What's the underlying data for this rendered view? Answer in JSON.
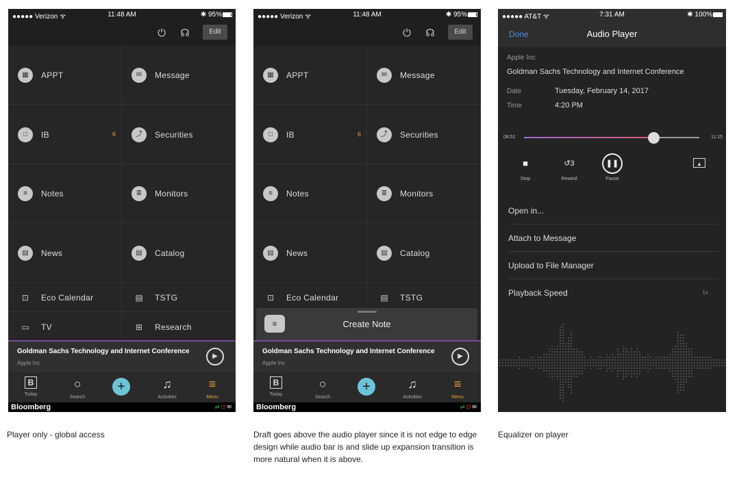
{
  "screens": [
    {
      "status": {
        "carrier": "●●●●● Verizon ᯤ",
        "time": "11:48 AM",
        "battery": "✱ 95%",
        "battery_level": 0.95
      },
      "edit_label": "Edit"
    },
    {
      "status": {
        "carrier": "●●●●● Verizon ᯤ",
        "time": "11:48 AM",
        "battery": "✱ 95%",
        "battery_level": 0.95
      },
      "edit_label": "Edit"
    }
  ],
  "tiles": [
    {
      "label": "APPT",
      "icon": "calendar-icon",
      "glyph": "▦"
    },
    {
      "label": "Message",
      "icon": "envelope-icon",
      "glyph": "✉"
    },
    {
      "label": "IB",
      "icon": "chat-icon",
      "glyph": "□",
      "badge": "6"
    },
    {
      "label": "Securities",
      "icon": "chart-icon",
      "glyph": "⤴"
    },
    {
      "label": "Notes",
      "icon": "notes-icon",
      "glyph": "≡"
    },
    {
      "label": "Monitors",
      "icon": "monitor-list-icon",
      "glyph": "≣"
    },
    {
      "label": "News",
      "icon": "news-icon",
      "glyph": "▤"
    },
    {
      "label": "Catalog",
      "icon": "catalog-icon",
      "glyph": "▤"
    },
    {
      "label": "Eco Calendar",
      "icon": "calendar-icon",
      "glyph": "⊡"
    },
    {
      "label": "TSTG",
      "icon": "news-icon",
      "glyph": "▤"
    },
    {
      "label": "TV",
      "icon": "tv-icon",
      "glyph": "▭"
    },
    {
      "label": "Research",
      "icon": "research-icon",
      "glyph": "⊞"
    }
  ],
  "player": {
    "title": "Goldman Sachs Technology and Internet Conference",
    "subtitle": "Apple Inc",
    "play_icon": "▶"
  },
  "tabs": [
    {
      "label": "Today",
      "glyph": "B",
      "icon": "bloomberg-b-icon"
    },
    {
      "label": "Search",
      "glyph": "○",
      "icon": "search-icon"
    },
    {
      "label": "Activities",
      "glyph": "♫",
      "icon": "bell-icon"
    },
    {
      "label": "Menu",
      "glyph": "≡",
      "icon": "menu-icon"
    }
  ],
  "plus_glyph": "+",
  "brand": "Bloomberg",
  "bottom_icons": {
    "sync": "⇄",
    "alert": "⊡",
    "mail": "✉"
  },
  "draft": {
    "title": "Create Note",
    "glyph": "≡"
  },
  "audio": {
    "status": {
      "carrier": "●●●●● AT&T ᯤ",
      "time": "7:31 AM",
      "battery": "✱ 100%",
      "battery_level": 1.0
    },
    "nav": {
      "done": "Done",
      "title": "Audio Player"
    },
    "company": "Apple Inc",
    "event": "Goldman Sachs Technology and Internet Conference",
    "date_key": "Date",
    "date_value": "Tuesday, February 14, 2017",
    "time_key": "Time",
    "time_value": "4:20 PM",
    "elapsed": "08:51",
    "total": "11:15",
    "progress": 0.74,
    "controls": [
      {
        "label": "Stop",
        "glyph": "■"
      },
      {
        "label": "Rewind",
        "glyph": "↺3"
      },
      {
        "label": "Pause",
        "glyph": "❚❚"
      }
    ],
    "airplay_glyph": "▲",
    "options": [
      "Open in...",
      "Attach to Message",
      "Upload to File Manager",
      "Playback Speed"
    ],
    "speed_value": "1x"
  },
  "captions": [
    "Player only - global access",
    "Draft goes above the audio player since it is not edge to edge design while audio bar is and slide up expansion transition is more natural when it is above.",
    "Equalizer on player"
  ],
  "colors": {
    "accent": "#e8a23c",
    "plus": "#6cc4d6",
    "done": "#4a90e2",
    "progress_start": "#a06bd6",
    "progress_end": "#e05b7a"
  }
}
